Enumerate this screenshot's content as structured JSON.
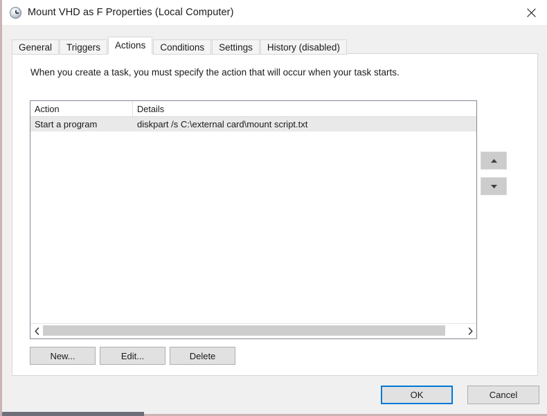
{
  "window": {
    "title": "Mount VHD as F Properties (Local Computer)",
    "title_icon": "clock-icon",
    "close_icon": "close-icon",
    "accent_color": "#0078d7",
    "dialog_background": "#f0f0f0",
    "panel_background": "#ffffff"
  },
  "tabs": [
    {
      "label": "General",
      "selected": false
    },
    {
      "label": "Triggers",
      "selected": false
    },
    {
      "label": "Actions",
      "selected": true
    },
    {
      "label": "Conditions",
      "selected": false
    },
    {
      "label": "Settings",
      "selected": false
    },
    {
      "label": "History (disabled)",
      "selected": false
    }
  ],
  "main": {
    "description": "When you create a task, you must specify the action that will occur when your task starts.",
    "table": {
      "columns": [
        "Action",
        "Details"
      ],
      "rows": [
        {
          "action": "Start a program",
          "details": "diskpart /s C:\\external card\\mount script.txt",
          "selected": true
        }
      ]
    },
    "scrollbar": {
      "left_arrow_icon": "chevron-left-icon",
      "right_arrow_icon": "chevron-right-icon",
      "thumb_color": "#cdcdcd"
    },
    "order_buttons": {
      "move_up_icon": "triangle-up-icon",
      "move_down_icon": "triangle-down-icon"
    },
    "buttons": {
      "new": "New...",
      "edit": "Edit...",
      "delete": "Delete"
    }
  },
  "footer": {
    "ok": "OK",
    "cancel": "Cancel"
  }
}
